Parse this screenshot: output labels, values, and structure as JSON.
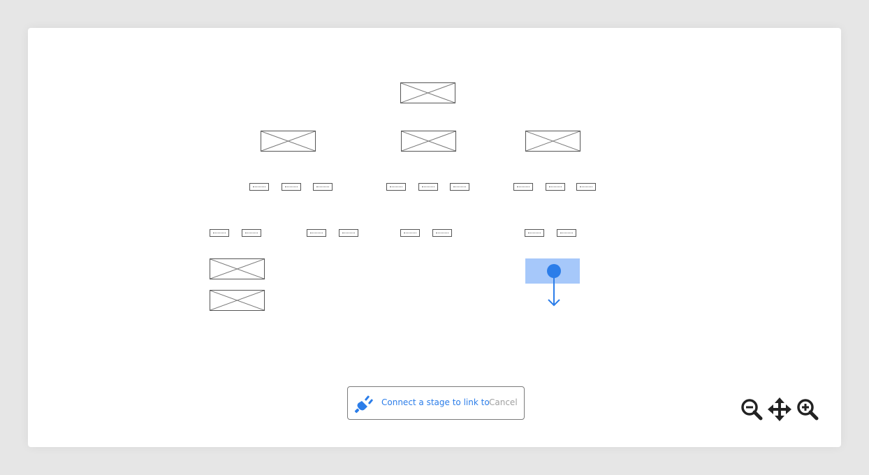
{
  "toast": {
    "icon": "plug-icon",
    "message": "Connect a stage to link to",
    "cancel_label": "Cancel"
  },
  "zoom_controls": {
    "zoom_out_icon": "zoom-out-icon",
    "pan_icon": "move-icon",
    "zoom_in_icon": "zoom-in-icon"
  },
  "colors": {
    "accent": "#2b7de9",
    "highlight": "#a6c8fa",
    "muted": "#a0a0a0"
  }
}
